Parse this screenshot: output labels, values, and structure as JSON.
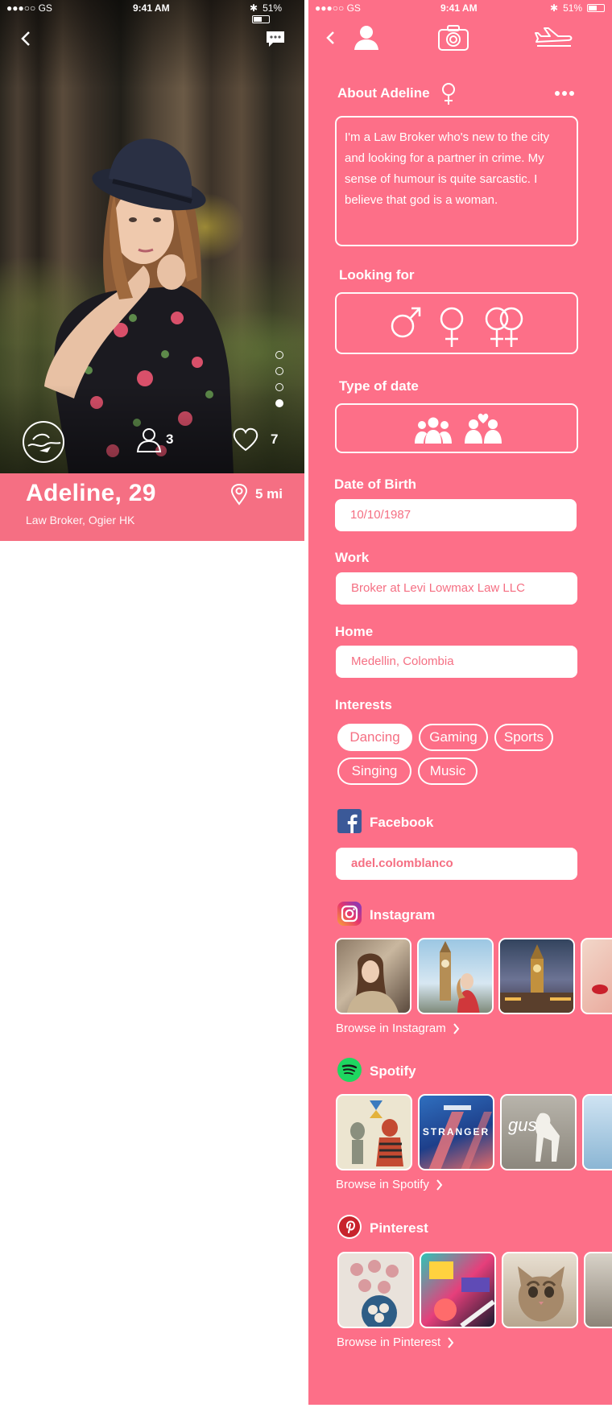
{
  "status_bar": {
    "carrier": "●●●○○ GS",
    "time": "9:41 AM",
    "battery": "51%"
  },
  "profile": {
    "name": "Adeline, 29",
    "occupation": "Law Broker, Ogier HK",
    "distance": "5 mi",
    "friends_count": "3",
    "likes_count": "7",
    "photo_pages": 4,
    "active_photo_index": 3
  },
  "detail": {
    "about_title": "About Adeline",
    "about_text": "I'm a Law Broker who's new to the city and looking for a partner in crime. My sense of humour is quite sarcastic. I believe that god is a woman.",
    "looking_for_title": "Looking for",
    "looking_for_icons": [
      "male-symbol-icon",
      "female-symbol-icon",
      "female-female-symbol-icon"
    ],
    "type_of_date_title": "Type of date",
    "type_of_date_icons": [
      "group-icon",
      "couple-heart-icon"
    ],
    "dob_label": "Date of Birth",
    "dob_value": "10/10/1987",
    "work_label": "Work",
    "work_value": "Broker at Levi Lowmax Law LLC",
    "home_label": "Home",
    "home_value": "Medellin, Colombia",
    "interests_label": "Interests",
    "interests": [
      {
        "label": "Dancing",
        "selected": true
      },
      {
        "label": "Gaming",
        "selected": false
      },
      {
        "label": "Sports",
        "selected": false
      },
      {
        "label": "Singing",
        "selected": false
      },
      {
        "label": "Music",
        "selected": false
      }
    ],
    "facebook_label": "Facebook",
    "facebook_value": "adel.colomblanco",
    "instagram_label": "Instagram",
    "instagram_browse": "Browse in Instagram",
    "spotify_label": "Spotify",
    "spotify_browse": "Browse in Spotify",
    "spotify_album_text": [
      "STRANGER",
      "gus"
    ],
    "pinterest_label": "Pinterest",
    "pinterest_browse": "Browse in Pinterest"
  },
  "colors": {
    "accent": "#fd6f88",
    "banner": "#f56f83",
    "white": "#ffffff"
  }
}
